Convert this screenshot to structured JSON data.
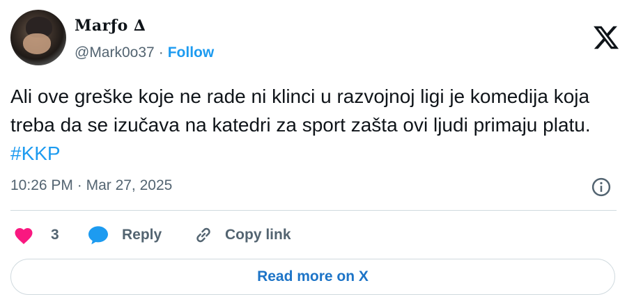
{
  "author": {
    "display_name": "Marƒo ∆",
    "handle": "@Mark0o37",
    "separator": "·",
    "follow_label": "Follow"
  },
  "tweet": {
    "text": "Ali ove greške koje ne rade ni klinci u razvojnoj ligi je komedija koja treba da se izučava na katedri za sport zašta ovi ljudi primaju platu.",
    "hashtag": "#KKP",
    "time": "10:26 PM",
    "separator": "·",
    "date": "Mar 27, 2025"
  },
  "actions": {
    "like_count": "3",
    "reply_label": "Reply",
    "copy_link_label": "Copy link"
  },
  "footer": {
    "read_more_label": "Read more on X"
  },
  "icons": {
    "logo": "x-logo-icon",
    "info": "info-icon",
    "like": "heart-icon",
    "reply": "reply-bubble-icon",
    "copy": "link-icon"
  },
  "colors": {
    "accent": "#1d9bf0",
    "text": "#0f1419",
    "secondary": "#536471",
    "heart": "#f91880",
    "border": "#cfd9de"
  }
}
